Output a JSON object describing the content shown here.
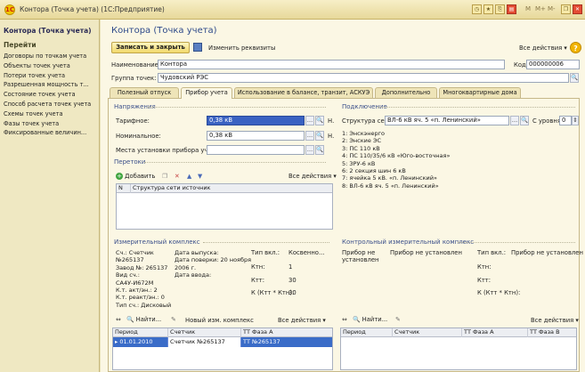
{
  "window": {
    "title": "Контора (Точка учета)  (1С:Предприятие)",
    "controls": [
      "M",
      "M+",
      "M-"
    ]
  },
  "left": {
    "title": "Контора (Точка учета)",
    "go": "Перейти",
    "items": [
      "Договоры по точкам учета",
      "Объекты точек учета",
      "Потери точек учета",
      "Разрешенная мощность т...",
      "Состояние точек учета",
      "Способ расчета точек учета",
      "Схемы точек учета",
      "Фазы точек учета",
      "Фиксированные величин..."
    ]
  },
  "form": {
    "title": "Контора (Точка учета)",
    "save_close": "Записать и закрыть",
    "edit_req": "Изменить реквизиты",
    "all_actions": "Все действия ▾",
    "name_label": "Наименование:",
    "name_value": "Контора",
    "code_label": "Код:",
    "code_value": "000000006",
    "group_label": "Группа точек:",
    "group_value": "Чудовский РЭС"
  },
  "tabs": [
    "Полезный отпуск",
    "Прибор учета",
    "Использование в балансе, транзит, АСКУЭ",
    "Дополнительно",
    "Многоквартирные дома"
  ],
  "voltage": {
    "section": "Напряжения",
    "tariff_label": "Тарифное:",
    "tariff_value": "0,38 кВ",
    "nominal_label": "Номинальное:",
    "nominal_value": "0,38 кВ",
    "place_label": "Места установки прибора учета:",
    "place_value": "",
    "h": "Н."
  },
  "connection": {
    "section": "Подключение",
    "struct_label": "Структура сети:",
    "struct_value": "ВЛ-6 кВ яч. 5 «п. Ленинский»",
    "level_label": "С уровня:",
    "level_value": "0",
    "tree": [
      "1: Энскэнерго",
      "2: Энские ЭС",
      "3: ПС 110 кВ",
      "4: ПС 110/35/6 кВ «Юго-восточная»",
      "5: ЗРУ-6 кВ",
      "6: 2 секция шин 6 кВ",
      "7: ячейка 5 кВ. «п. Ленинский»",
      "8: ВЛ-6 кВ яч. 5 «п. Ленинский»"
    ]
  },
  "transfers": {
    "section": "Перетоки",
    "add": "Добавить",
    "all_actions": "Все действия ▾",
    "col_n": "N",
    "col_struct": "Структура сети источник"
  },
  "meter": {
    "section": "Измерительный комплекс",
    "col1": [
      "Сч.: Счетчик",
      "№265137",
      "Завод №: 265137",
      "Вид сч.:",
      "СА4У-И672М",
      "К.т. акт/эн.: 2",
      "К.т. реакт/эн.: 0",
      "Тип сч.: Дисковый"
    ],
    "col2": [
      "Дата выпуска:",
      "Дата поверки: 20 ноября",
      "2006 г.",
      "Дата ввода:"
    ],
    "incl_label": "Тип вкл.:",
    "incl_value": "Косвенно...",
    "ktn_label": "Ктн:",
    "ktn_value": "1",
    "ktt_label": "Ктт:",
    "ktt_value": "30",
    "k_label": "К (Ктт * Ктн):",
    "k_value": "30"
  },
  "control": {
    "section": "Контрольный измерительный комплекс",
    "dev_label": "Прибор не установлен",
    "dev2": "Прибор не установлен",
    "incl_label": "Тип вкл.:",
    "incl_value": "Прибор не установлен",
    "ktn_label": "Ктн:",
    "ktt_label": "Ктт:",
    "k_label": "К (Ктт * Ктн):"
  },
  "grid_left": {
    "find": "Найти...",
    "new_complex": "Новый изм. комплекс",
    "all_actions": "Все действия ▾",
    "cols": [
      "Период",
      "Счетчик",
      "ТТ Фаза А"
    ],
    "row": [
      "01.01.2010",
      "Счетчик №265137",
      "ТТ №265137"
    ]
  },
  "grid_right": {
    "find": "Найти...",
    "all_actions": "Все действия ▾",
    "cols": [
      "Период",
      "Счетчик",
      "ТТ Фаза А",
      "ТТ Фаза В"
    ]
  }
}
